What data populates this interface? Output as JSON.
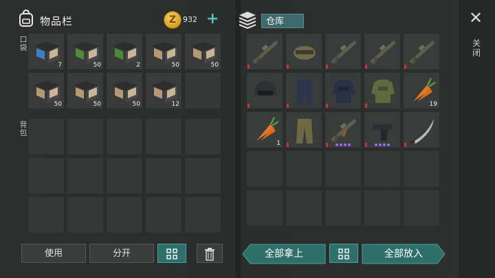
{
  "header": {
    "title": "物品栏",
    "coins": "932",
    "coin_symbol": "Z"
  },
  "labels": {
    "pocket": "口袋",
    "backpack": "背包"
  },
  "pocket_items": [
    {
      "icon": "manual-blue-icon",
      "qty": "7",
      "color": "#3d7fc4"
    },
    {
      "icon": "manual-green-icon",
      "qty": "50",
      "color": "#4d8a3a"
    },
    {
      "icon": "manual-green-icon",
      "qty": "2",
      "color": "#4d8a3a"
    },
    {
      "icon": "manual-beige-icon",
      "qty": "50",
      "color": "#b49a74"
    },
    {
      "icon": "manual-beige-icon",
      "qty": "50",
      "color": "#b49a74"
    },
    {
      "icon": "manual-beige-icon",
      "qty": "50",
      "color": "#b49a74"
    },
    {
      "icon": "manual-beige-icon",
      "qty": "50",
      "color": "#b49a74"
    },
    {
      "icon": "manual-beige-icon",
      "qty": "50",
      "color": "#b49a74"
    },
    {
      "icon": "manual-beige-icon",
      "qty": "12",
      "color": "#b49a74"
    }
  ],
  "warehouse": {
    "title": "仓库"
  },
  "storage_items": [
    {
      "icon": "rifle-icon",
      "qty": "",
      "dura": true
    },
    {
      "icon": "helmet-cap-icon",
      "qty": "",
      "dura": true
    },
    {
      "icon": "rifle-icon",
      "qty": "",
      "dura": true
    },
    {
      "icon": "rifle-icon",
      "qty": "",
      "dura": true
    },
    {
      "icon": "rifle-icon",
      "qty": "",
      "dura": true
    },
    {
      "icon": "helmet-icon",
      "qty": "",
      "dura": true
    },
    {
      "icon": "pants-icon",
      "qty": "",
      "dura": true
    },
    {
      "icon": "armor-vest-icon",
      "qty": "",
      "dura": true
    },
    {
      "icon": "camo-jacket-icon",
      "qty": "",
      "dura": true
    },
    {
      "icon": "carrot-icon",
      "qty": "19",
      "dura": false
    },
    {
      "icon": "carrot-icon",
      "qty": "1",
      "dura": false
    },
    {
      "icon": "camo-pants-icon",
      "qty": "",
      "dura": true
    },
    {
      "icon": "ak-rifle-icon",
      "qty": "",
      "dura": true,
      "dots": 4
    },
    {
      "icon": "pistol-icon",
      "qty": "",
      "dura": true,
      "dots": 4
    },
    {
      "icon": "machete-icon",
      "qty": "",
      "dura": true
    }
  ],
  "buttons": {
    "use": "使用",
    "split": "分开",
    "take_all": "全部拿上",
    "put_all": "全部放入"
  },
  "close": {
    "label": "关闭"
  },
  "colors": {
    "accent": "#3e9a93",
    "durability": "#c9342c",
    "rarity": "#9c6cf0"
  }
}
